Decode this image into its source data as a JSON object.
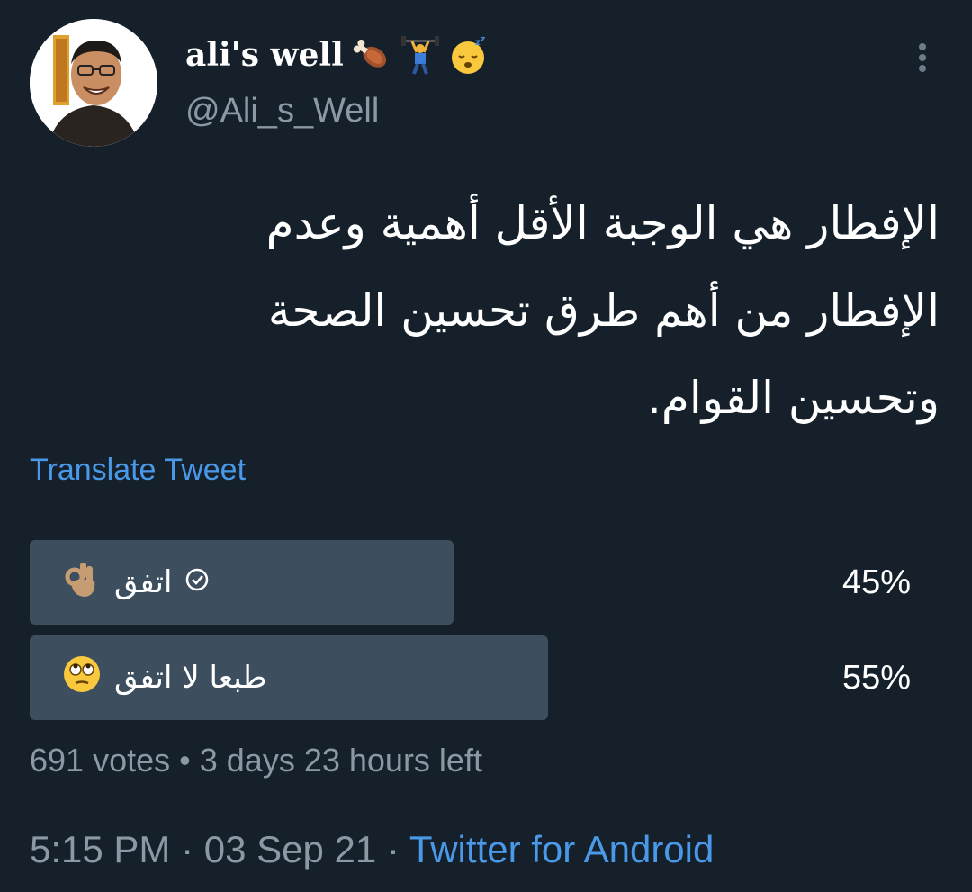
{
  "tweet": {
    "display_name": "ali's well",
    "name_emojis": [
      "meat-on-bone-icon",
      "weightlifter-icon",
      "sleeping-face-icon"
    ],
    "handle": "@Ali_s_Well",
    "text_lines": [
      "الإفطار هي الوجبة الأقل أهمية وعدم",
      "الإفطار من أهم طرق تحسين الصحة",
      "وتحسين القوام."
    ],
    "translate_label": "Translate Tweet"
  },
  "poll": {
    "options": [
      {
        "label": "اتفق",
        "emoji": "ok-hand-icon",
        "percent_text": "45%",
        "percent": 45,
        "selected": true
      },
      {
        "label": "طبعا لا اتفق",
        "emoji": "face-rolling-eyes-icon",
        "percent_text": "55%",
        "percent": 55,
        "selected": false
      }
    ],
    "votes": "691 votes",
    "time_left": "3 days 23 hours left",
    "separator": "•"
  },
  "footer": {
    "time": "5:15 PM",
    "date": "03 Sep 21",
    "source": "Twitter for Android",
    "separator": "·"
  },
  "colors": {
    "background": "#15202b",
    "accent": "#4a99e9",
    "muted": "#8b98a5",
    "poll_bar": "#3d4e5f"
  }
}
